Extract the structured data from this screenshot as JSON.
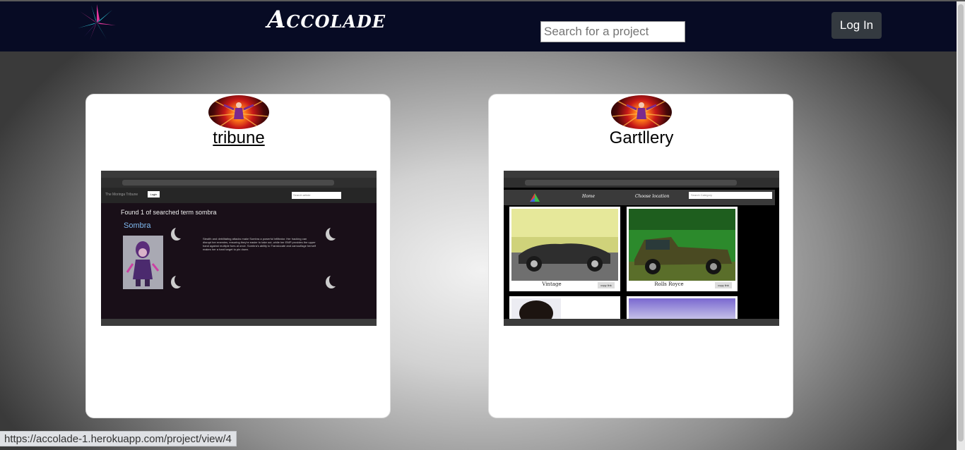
{
  "header": {
    "brand": "Accolade",
    "search_placeholder": "Search for a project",
    "login_label": "Log In",
    "logo_icon": "starburst-logo-icon",
    "background": "#070b24"
  },
  "projects": [
    {
      "title": "tribune",
      "title_is_link": true,
      "avatar_icon": "user-avatar-icon",
      "screenshot": {
        "nav_brand": "The Moringa Tribune",
        "nav_login": "Login",
        "nav_search": "Search article",
        "found_text": "Found 1 of searched term sombra",
        "result_title": "Sombra",
        "description": "Stealth and debilitating attacks make Sombra a powerful infiltrator. Her hacking can disrupt her enemies, ensuring they're easier to take out, while her EMP provides the upper hand against multiple foes at once. Sombra's ability to Translocate and camouflage herself makes her a hard target to pin down."
      }
    },
    {
      "title": "Gartllery",
      "title_is_link": false,
      "avatar_icon": "user-avatar-icon",
      "screenshot": {
        "nav_home": "Home",
        "nav_location": "Choose location",
        "nav_search": "Search Category",
        "photos": [
          {
            "caption": "Vintage",
            "button": "copy link"
          },
          {
            "caption": "Rolls Royce",
            "button": "copy link"
          }
        ]
      }
    }
  ],
  "status_bar": {
    "url": "https://accolade-1.herokuapp.com/project/view/4"
  }
}
